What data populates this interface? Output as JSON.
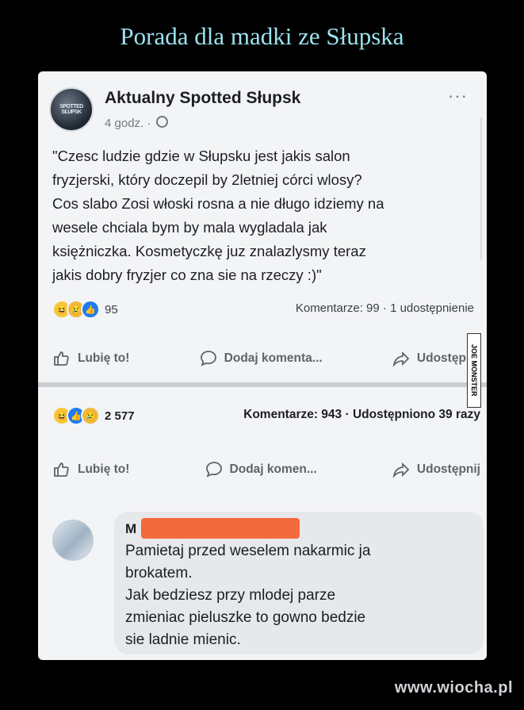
{
  "header": {
    "title": "Porada dla madki ze Słupska"
  },
  "post": {
    "page_name": "Aktualny Spotted Słupsk",
    "avatar_text": "SPOTTED SŁUPSK",
    "time": "4 godz. ·",
    "more": "···",
    "text_lines": [
      "\"Czesc ludzie gdzie w Słupsku jest jakis salon",
      "fryzjerski, który doczepil by 2letniej córci wlosy?",
      "Cos slabo Zosi włoski rosna a nie długo idziemy na",
      "wesele chciala bym by mala wygladala jak",
      "księżniczka. Kosmetyczkę juz znalazlysmy teraz",
      "jakis dobry fryzjer co zna sie na rzeczy :)\""
    ],
    "reactions_count": "95",
    "stats": "Komentarze: 99 · 1 udostępnienie",
    "actions": {
      "like": "Lubię to!",
      "comment": "Dodaj komenta...",
      "share": "Udostępnij"
    }
  },
  "watermark_side": "JOE MONSTER",
  "second": {
    "reactions_count": "2 577",
    "stats": "Komentarze: 943 · Udostępniono 39 razy",
    "actions": {
      "like": "Lubię to!",
      "comment": "Dodaj komen...",
      "share": "Udostępnij"
    }
  },
  "comment": {
    "author_initial": "M",
    "lines": [
      "Pamietaj przed weselem nakarmic ja",
      "brokatem.",
      "Jak bedziesz przy mlodej parze",
      "zmieniac pieluszke to gowno bedzie",
      "sie ladnie mienic."
    ]
  },
  "footer": {
    "site": "www.wiocha.pl"
  },
  "colors": {
    "title": "#9be3ef",
    "redaction": "#f36a3c",
    "like_blue": "#1d7bf2"
  }
}
